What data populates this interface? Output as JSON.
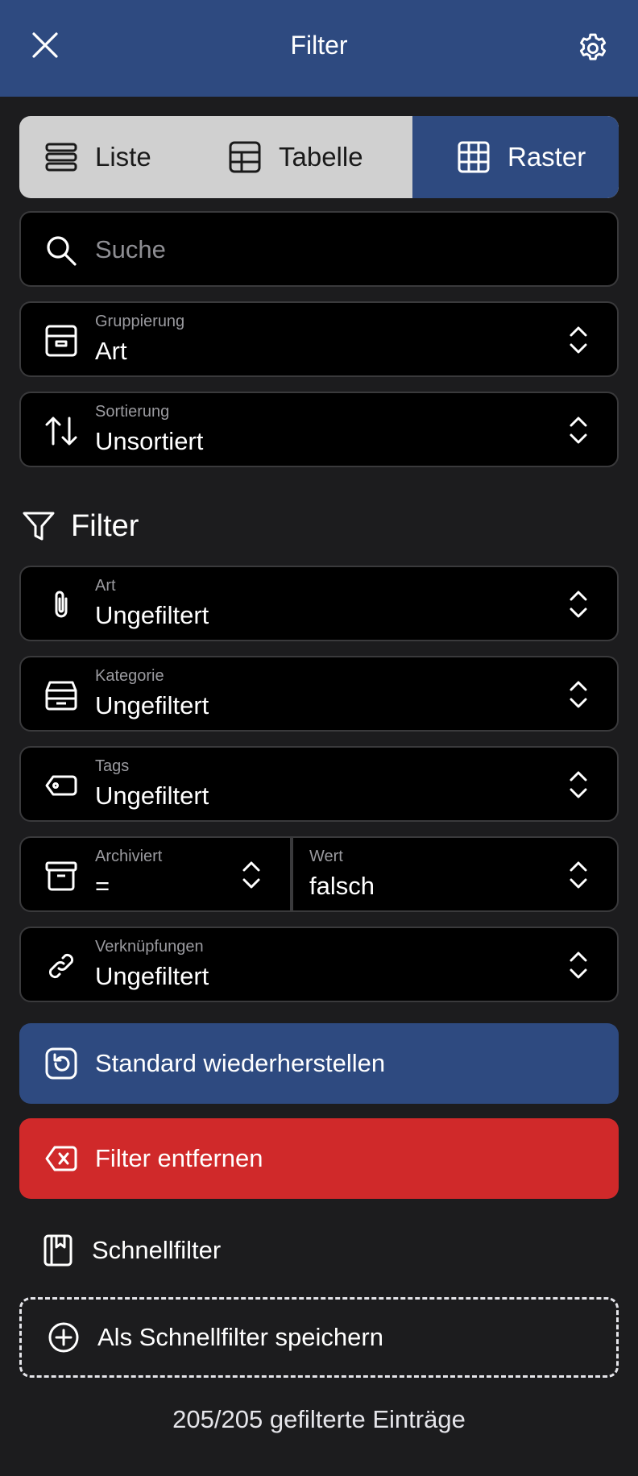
{
  "header": {
    "title": "Filter",
    "close_icon": "close-icon",
    "settings_icon": "gear-icon",
    "color": "#2e4a80"
  },
  "view_switch": {
    "selected": "Raster",
    "options": [
      {
        "label": "Liste",
        "icon": "list-icon"
      },
      {
        "label": "Tabelle",
        "icon": "table-icon"
      },
      {
        "label": "Raster",
        "icon": "grid-icon"
      }
    ]
  },
  "search": {
    "placeholder": "Suche",
    "value": ""
  },
  "grouping": {
    "label": "Gruppierung",
    "value": "Art"
  },
  "sorting": {
    "label": "Sortierung",
    "value": "Unsortiert"
  },
  "filter_section": {
    "title": "Filter",
    "art": {
      "label": "Art",
      "value": "Ungefiltert"
    },
    "kategorie": {
      "label": "Kategorie",
      "value": "Ungefiltert"
    },
    "tags": {
      "label": "Tags",
      "value": "Ungefiltert"
    },
    "archiviert": {
      "label": "Archiviert",
      "operator": "=",
      "value_label": "Wert",
      "value": "falsch"
    },
    "verknuepfungen": {
      "label": "Verknüpfungen",
      "value": "Ungefiltert"
    }
  },
  "actions": {
    "restore_label": "Standard wiederherstellen",
    "remove_label": "Filter entfernen",
    "restore_color": "#2e4a80",
    "remove_color": "#d0292a"
  },
  "quick_filter": {
    "title": "Schnellfilter",
    "save_label": "Als Schnellfilter speichern"
  },
  "footer": {
    "count_text": "205/205 gefilterte Einträge"
  }
}
